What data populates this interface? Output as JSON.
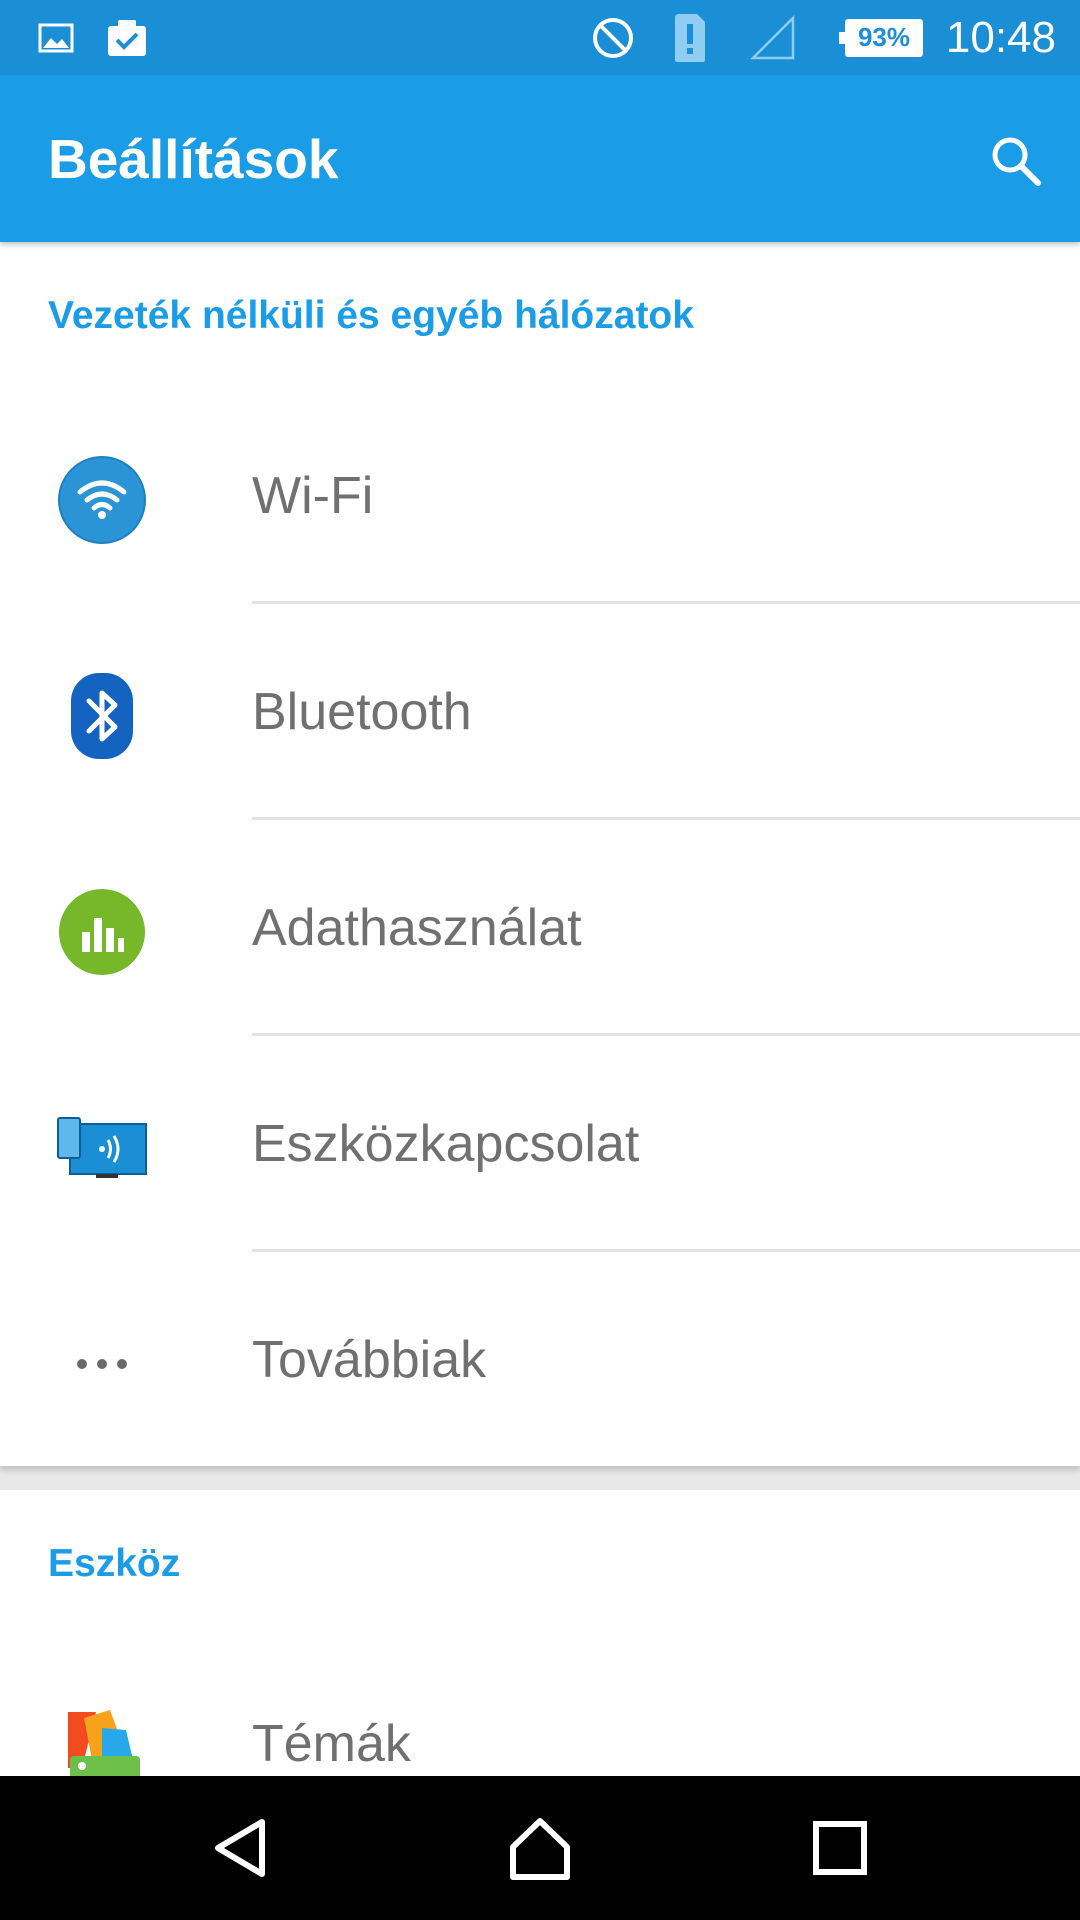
{
  "status_bar": {
    "icons": [
      "image-icon",
      "clipboard-check-icon",
      "do-not-disturb-icon",
      "sim-alert-icon",
      "signal-icon"
    ],
    "battery": "93%",
    "time": "10:48"
  },
  "app_bar": {
    "title": "Beállítások",
    "search_icon": "search-icon"
  },
  "sections": [
    {
      "header": "Vezeték nélküli és egyéb hálózatok",
      "items": [
        {
          "label": "Wi-Fi",
          "icon": "wifi-icon"
        },
        {
          "label": "Bluetooth",
          "icon": "bluetooth-icon"
        },
        {
          "label": "Adathasználat",
          "icon": "data-usage-icon"
        },
        {
          "label": "Eszközkapcsolat",
          "icon": "device-connection-icon"
        },
        {
          "label": "Továbbiak",
          "icon": "more-icon"
        }
      ]
    },
    {
      "header": "Eszköz",
      "items": [
        {
          "label": "Témák",
          "icon": "themes-icon"
        }
      ]
    }
  ],
  "nav_bar": {
    "buttons": [
      "back-icon",
      "home-icon",
      "recents-icon"
    ]
  },
  "colors": {
    "status_bar": "#1a8fd6",
    "app_bar": "#1b9ce6",
    "accent": "#1b9ce6",
    "label_text": "#707070"
  }
}
